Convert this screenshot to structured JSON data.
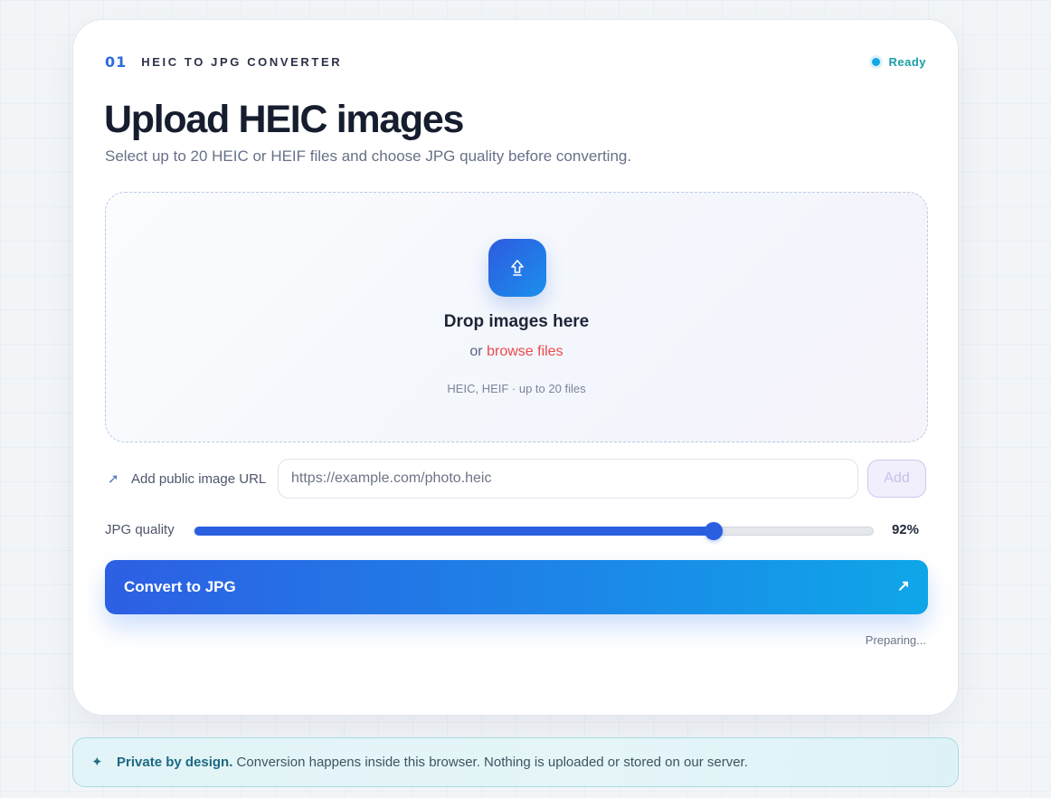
{
  "header": {
    "step_number": "01",
    "step_label": "HEIC TO JPG CONVERTER",
    "status_text": "Ready",
    "status_color": "#14a7e6"
  },
  "main": {
    "title": "Upload HEIC images",
    "subtitle": "Select up to 20 HEIC or HEIF files and choose JPG quality before converting."
  },
  "dropzone": {
    "icon": "upload-arrow-icon",
    "title": "Drop images here",
    "or_text": "or",
    "browse_link": "browse files",
    "hint": "HEIC, HEIF · up to 20 files"
  },
  "url": {
    "icon": "link-arrow-icon",
    "label": "Add public image URL",
    "placeholder": "https://example.com/photo.heic",
    "value": "",
    "add_label": "Add"
  },
  "quality": {
    "label": "JPG quality",
    "value": 92,
    "display": "92%",
    "fill_fraction": 0.765
  },
  "convert": {
    "label": "Convert to JPG",
    "arrow": "↗",
    "status": "Preparing..."
  },
  "privacy": {
    "icon": "sparkle-icon",
    "strong": "Private by design.",
    "text": " Conversion happens inside this browser. Nothing is uploaded or stored on our server."
  },
  "colors": {
    "accent": "#2a5fe0",
    "link": "#ea4a4a",
    "status_green": "#1a9fa6"
  }
}
